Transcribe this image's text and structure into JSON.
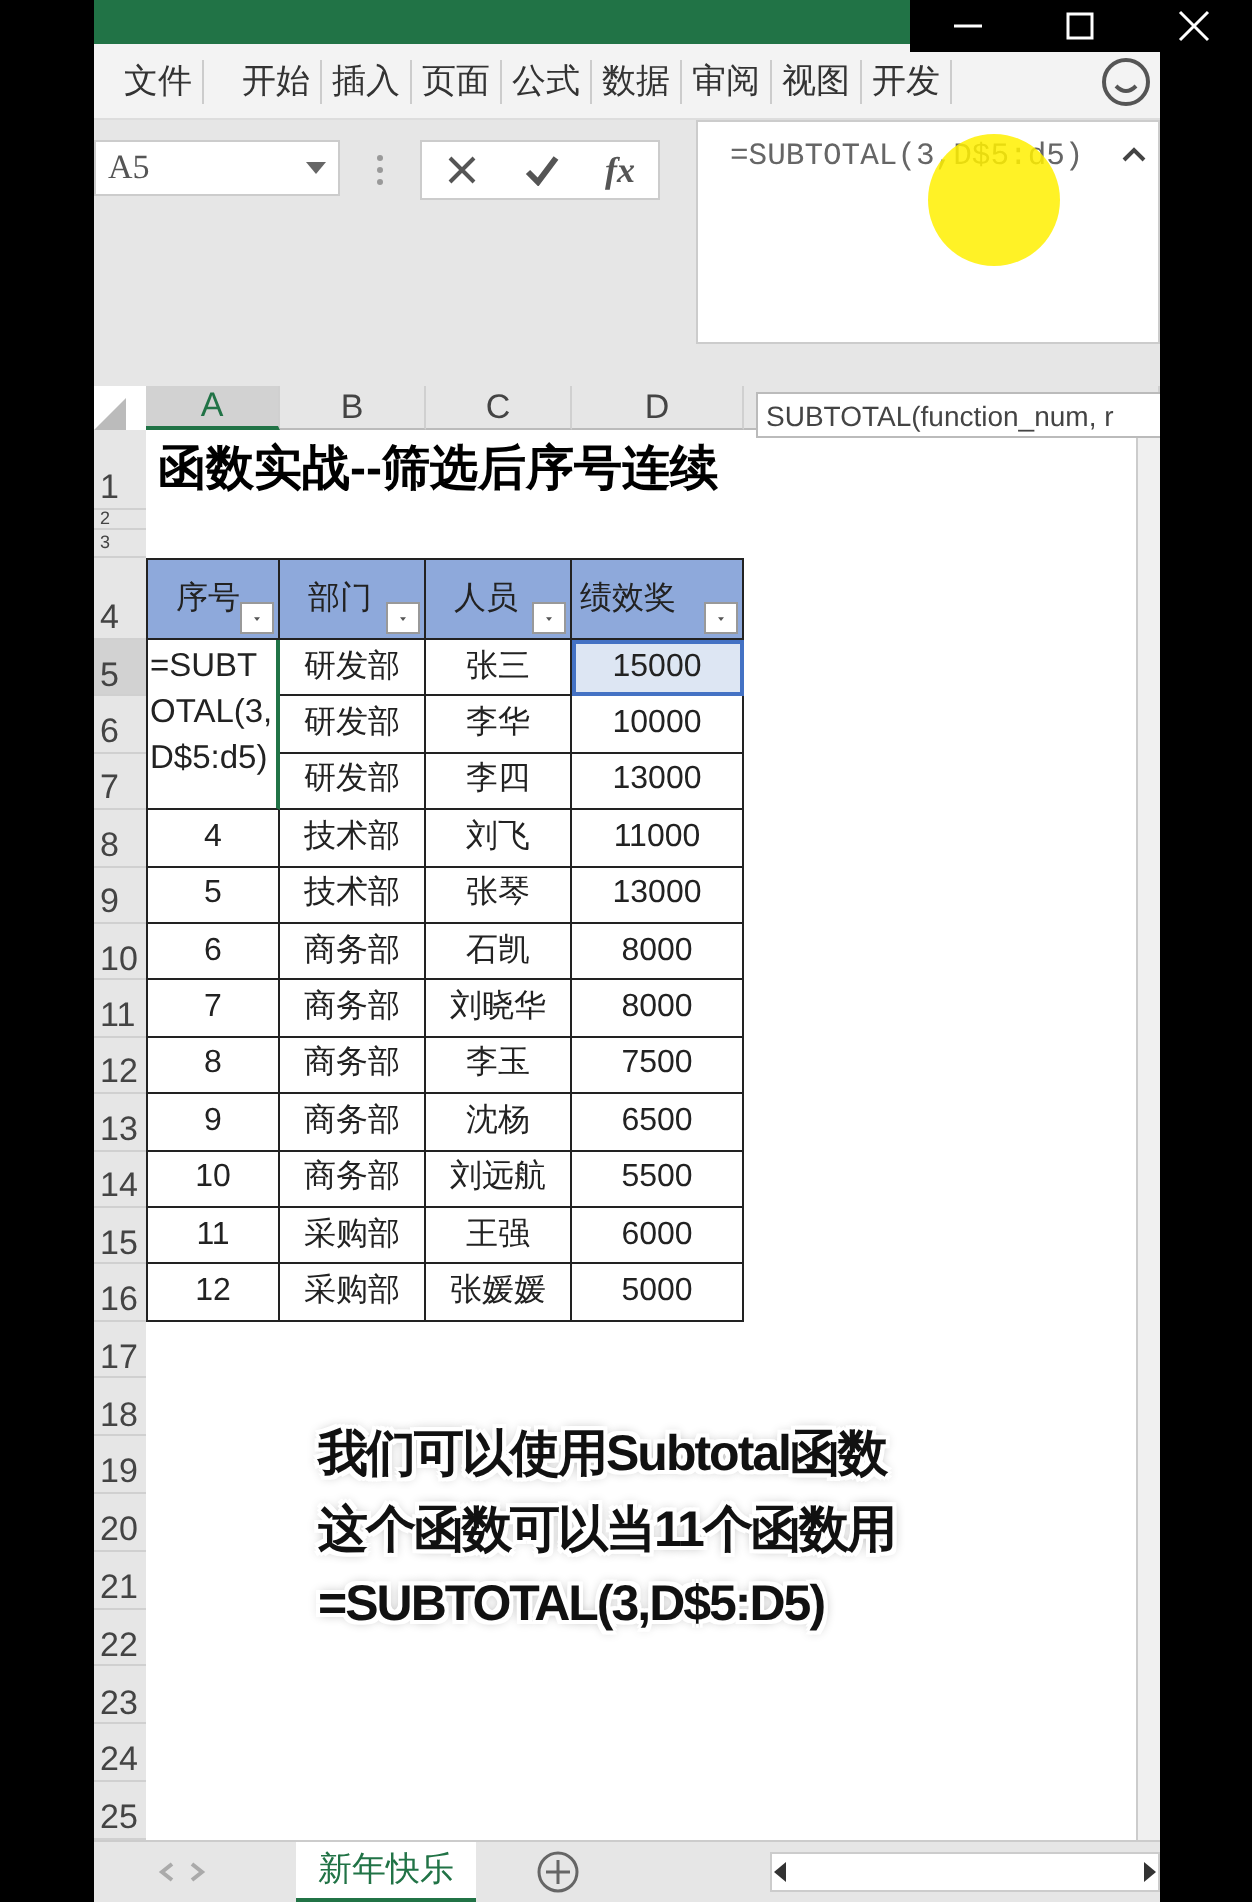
{
  "ribbon": {
    "tabs": [
      {
        "label": "文件"
      },
      {
        "label": "开始"
      },
      {
        "label": "插入"
      },
      {
        "label": "页面"
      },
      {
        "label": "公式"
      },
      {
        "label": "数据"
      },
      {
        "label": "审阅"
      },
      {
        "label": "视图"
      },
      {
        "label": "开发"
      }
    ]
  },
  "formula_bar": {
    "name_box": "A5",
    "fx": "fx",
    "formula": "=SUBTOTAL(3,D$5:d5)"
  },
  "tooltip": "SUBTOTAL(function_num, r",
  "sheet": {
    "columns": [
      {
        "label": "A",
        "selected": true
      },
      {
        "label": "B",
        "selected": false
      },
      {
        "label": "C",
        "selected": false
      },
      {
        "label": "D",
        "selected": false
      }
    ],
    "row_labels": [
      "1",
      "2",
      "3",
      "4",
      "5",
      "6",
      "7",
      "8",
      "9",
      "10",
      "11",
      "12",
      "13",
      "14",
      "15",
      "16",
      "17",
      "18",
      "19",
      "20",
      "21",
      "22",
      "23",
      "24",
      "25"
    ],
    "title": "函数实战--筛选后序号连续",
    "headers": [
      "序号",
      "部门",
      "人员",
      "绩效奖"
    ],
    "rows": [
      {
        "seq": "=SUBTOTAL(3,D$5:d5)",
        "dept": "研发部",
        "person": "张三",
        "bonus": "15000",
        "selected": true
      },
      {
        "dept": "研发部",
        "person": "李华",
        "bonus": "10000",
        "selected": false
      },
      {
        "dept": "研发部",
        "person": "李四",
        "bonus": "13000",
        "selected": false
      },
      {
        "seq": "4",
        "dept": "技术部",
        "person": "刘飞",
        "bonus": "11000",
        "selected": false
      },
      {
        "seq": "5",
        "dept": "技术部",
        "person": "张琴",
        "bonus": "13000",
        "selected": false
      },
      {
        "seq": "6",
        "dept": "商务部",
        "person": "石凯",
        "bonus": "8000",
        "selected": false
      },
      {
        "seq": "7",
        "dept": "商务部",
        "person": "刘晓华",
        "bonus": "8000",
        "selected": false
      },
      {
        "seq": "8",
        "dept": "商务部",
        "person": "李玉",
        "bonus": "7500",
        "selected": false
      },
      {
        "seq": "9",
        "dept": "商务部",
        "person": "沈杨",
        "bonus": "6500",
        "selected": false
      },
      {
        "seq": "10",
        "dept": "商务部",
        "person": "刘远航",
        "bonus": "5500",
        "selected": false
      },
      {
        "seq": "11",
        "dept": "采购部",
        "person": "王强",
        "bonus": "6000",
        "selected": false
      },
      {
        "seq": "12",
        "dept": "采购部",
        "person": "张媛媛",
        "bonus": "5000",
        "selected": false
      }
    ]
  },
  "caption": [
    "我们可以使用Subtotal函数",
    "这个函数可以当11个函数用",
    "=SUBTOTAL(3,D$5:D5)"
  ],
  "sheet_tabs": [
    {
      "label": "新年快乐",
      "selected": true
    }
  ]
}
